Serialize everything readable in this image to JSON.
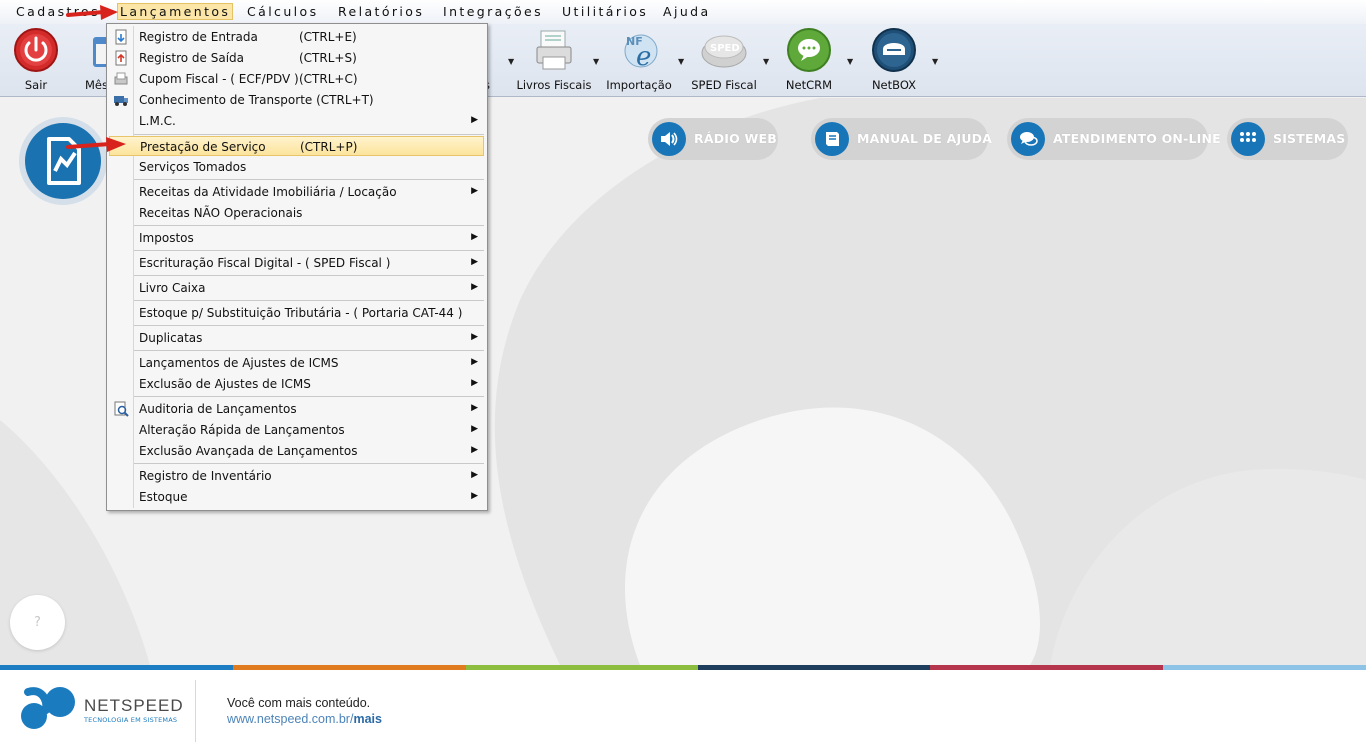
{
  "menubar": {
    "items": [
      {
        "label": "Cadastros"
      },
      {
        "label": "Lançamentos"
      },
      {
        "label": "Cálculos"
      },
      {
        "label": "Relatórios"
      },
      {
        "label": "Integrações"
      },
      {
        "label": "Utilitários"
      },
      {
        "label": "Ajuda"
      }
    ]
  },
  "toolbar": {
    "buttons": [
      {
        "label": "Sair",
        "icon": "power-icon"
      },
      {
        "label": "Mês",
        "icon": "calendar-icon"
      },
      {
        "label": "s",
        "icon": "hidden-icon"
      },
      {
        "label": "Livros Fiscais",
        "icon": "printer-icon"
      },
      {
        "label": "Importação",
        "icon": "nfe-icon"
      },
      {
        "label": "SPED Fiscal",
        "icon": "sped-icon"
      },
      {
        "label": "NetCRM",
        "icon": "chat-icon"
      },
      {
        "label": "NetBOX",
        "icon": "box-icon"
      }
    ]
  },
  "menu": {
    "items": [
      {
        "label": "Registro de Entrada",
        "shortcut": "(CTRL+E)"
      },
      {
        "label": "Registro de Saída",
        "shortcut": "(CTRL+S)"
      },
      {
        "label": "Cupom Fiscal - ( ECF/PDV )",
        "shortcut": "(CTRL+C)"
      },
      {
        "label": "Conhecimento de Transporte (CTRL+T)",
        "shortcut": ""
      },
      {
        "label": "L.M.C.",
        "shortcut": ""
      },
      {
        "label": "Prestação de Serviço",
        "shortcut": "(CTRL+P)"
      },
      {
        "label": "Serviços Tomados",
        "shortcut": ""
      },
      {
        "label": "Receitas da Atividade Imobiliária / Locação",
        "shortcut": ""
      },
      {
        "label": "Receitas NÃO Operacionais",
        "shortcut": ""
      },
      {
        "label": "Impostos",
        "shortcut": ""
      },
      {
        "label": "Escrituração Fiscal Digital - ( SPED Fiscal )",
        "shortcut": ""
      },
      {
        "label": "Livro Caixa",
        "shortcut": ""
      },
      {
        "label": "Estoque p/ Substituição Tributária - ( Portaria CAT-44 )",
        "shortcut": ""
      },
      {
        "label": "Duplicatas",
        "shortcut": ""
      },
      {
        "label": "Lançamentos de Ajustes de ICMS",
        "shortcut": ""
      },
      {
        "label": "Exclusão de Ajustes de ICMS",
        "shortcut": ""
      },
      {
        "label": "Auditoria de Lançamentos",
        "shortcut": ""
      },
      {
        "label": "Alteração Rápida de Lançamentos",
        "shortcut": ""
      },
      {
        "label": "Exclusão Avançada de Lançamentos",
        "shortcut": ""
      },
      {
        "label": "Registro de Inventário",
        "shortcut": ""
      },
      {
        "label": "Estoque",
        "shortcut": ""
      }
    ]
  },
  "quick_buttons": [
    {
      "label": "RÁDIO WEB",
      "icon": "speaker-icon"
    },
    {
      "label": "MANUAL DE AJUDA",
      "icon": "book-icon"
    },
    {
      "label": "ATENDIMENTO ON-LINE",
      "icon": "chat-bubbles-icon"
    },
    {
      "label": "SISTEMAS",
      "icon": "grid-icon"
    }
  ],
  "help_button": {
    "label": "?"
  },
  "footer": {
    "brand": "NETSPEED",
    "tagline": "TECNOLOGIA EM SISTEMAS",
    "line1": "Você com mais conteúdo.",
    "url_prefix": "www.netspeed.com.br/",
    "url_bold": "mais"
  },
  "colors": {
    "accent_blue": "#1876b8",
    "highlight": "#fce49c",
    "stripes": [
      "#1d7dc2",
      "#e07c1f",
      "#8cbd3f",
      "#1f3d5c",
      "#b5364c",
      "#8ec3e8"
    ]
  }
}
